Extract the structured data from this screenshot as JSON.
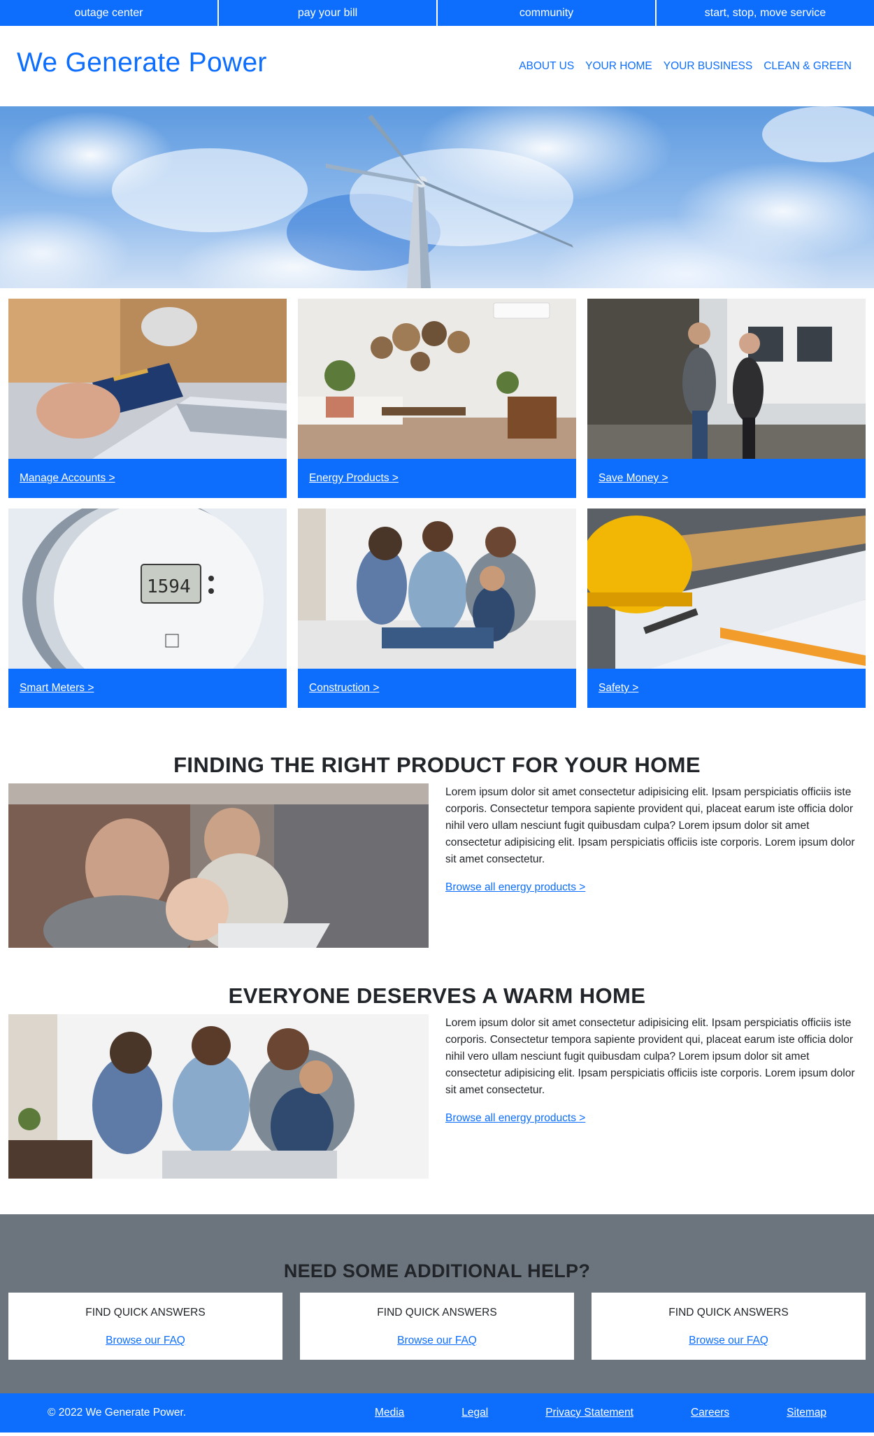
{
  "utility_nav": {
    "items": [
      "outage center",
      "pay your bill",
      "community",
      "start, stop, move service"
    ]
  },
  "header": {
    "brand": "We Generate Power",
    "nav": [
      "ABOUT US",
      "YOUR HOME",
      "YOUR BUSINESS",
      "CLEAN & GREEN"
    ]
  },
  "tiles": [
    {
      "label": "Manage Accounts >"
    },
    {
      "label": "Energy Products >"
    },
    {
      "label": "Save Money >"
    },
    {
      "label": "Smart Meters >"
    },
    {
      "label": "Construction >"
    },
    {
      "label": "Safety >"
    }
  ],
  "features": [
    {
      "title": "FINDING THE RIGHT PRODUCT FOR YOUR HOME",
      "body": "Lorem ipsum dolor sit amet consectetur adipisicing elit. Ipsam perspiciatis officiis iste corporis. Consectetur tempora sapiente provident qui, placeat earum iste officia dolor nihil vero ullam nesciunt fugit quibusdam culpa? Lorem ipsum dolor sit amet consectetur adipisicing elit. Ipsam perspiciatis officiis iste corporis. Lorem ipsum dolor sit amet consectetur.",
      "link": "Browse all energy products >"
    },
    {
      "title": "EVERYONE DESERVES A WARM HOME",
      "body": "Lorem ipsum dolor sit amet consectetur adipisicing elit. Ipsam perspiciatis officiis iste corporis. Consectetur tempora sapiente provident qui, placeat earum iste officia dolor nihil vero ullam nesciunt fugit quibusdam culpa? Lorem ipsum dolor sit amet consectetur adipisicing elit. Ipsam perspiciatis officiis iste corporis. Lorem ipsum dolor sit amet consectetur.",
      "link": "Browse all energy products >"
    }
  ],
  "help": {
    "title": "NEED SOME ADDITIONAL HELP?",
    "cards": [
      {
        "heading": "FIND QUICK ANSWERS",
        "link": "Browse our FAQ"
      },
      {
        "heading": "FIND QUICK ANSWERS",
        "link": "Browse our FAQ"
      },
      {
        "heading": "FIND QUICK ANSWERS",
        "link": "Browse our FAQ"
      }
    ]
  },
  "footer": {
    "copyright": "© 2022 We Generate Power.",
    "links": [
      "Media",
      "Legal",
      "Privacy Statement",
      "Careers",
      "Sitemap"
    ]
  },
  "colors": {
    "primary": "#0d6efd",
    "help_background": "#6c757d",
    "text": "#212529"
  }
}
